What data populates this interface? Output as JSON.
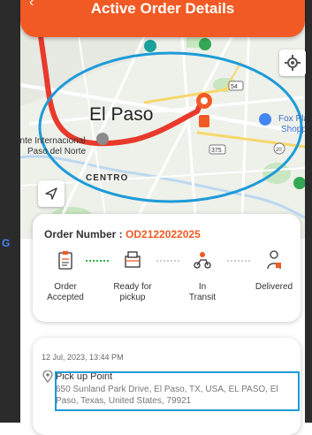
{
  "header": {
    "title": "Active Order Details"
  },
  "map": {
    "city_label": "El Paso",
    "district_label": "CENTRO",
    "poi_line1": "ente Internacional",
    "poi_line2": "Paso del Norte",
    "mall_line1": "Fox Plaz",
    "mall_line2": "Shoppin",
    "route_color": "#e8392b",
    "highlight_color": "#1e9bd8",
    "google_mark": "G"
  },
  "order": {
    "number_label": "Order Number : ",
    "number_value": "OD2122022025",
    "accent_color": "#f15a24",
    "steps": [
      {
        "label_line1": "Order",
        "label_line2": "Accepted",
        "icon": "clipboard-icon"
      },
      {
        "label_line1": "Ready for",
        "label_line2": "pickup",
        "icon": "package-icon"
      },
      {
        "label_line1": "In",
        "label_line2": "Transit",
        "icon": "scooter-icon"
      },
      {
        "label_line1": "Delivered",
        "label_line2": "",
        "icon": "courier-icon"
      }
    ]
  },
  "details": {
    "date": "12 Jul, 2023, 13:44 PM",
    "pickup_title": "Pick up Point",
    "pickup_address": "650 Sunland Park Drive, El Paso, TX, USA, EL PASO, El Paso, Texas, United States, 79921"
  }
}
